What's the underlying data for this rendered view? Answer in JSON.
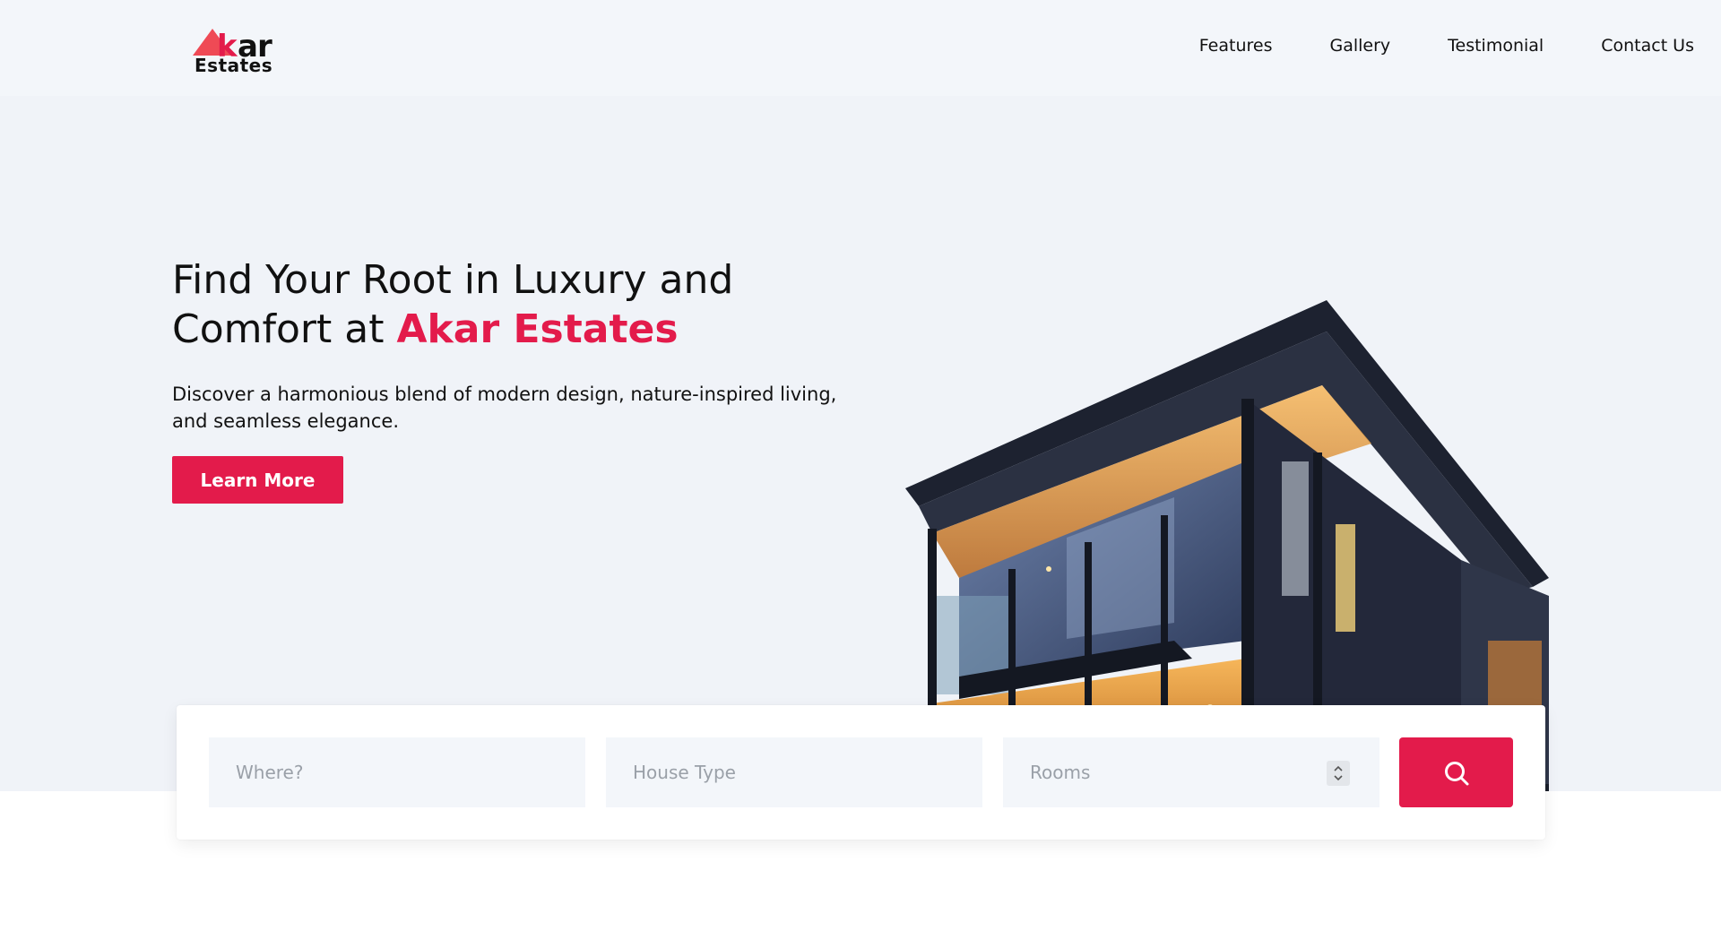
{
  "brand": {
    "logo_prefix_k": "k",
    "logo_suffix": "ar",
    "logo_sub": "Estates",
    "accent_color": "#e31b4b"
  },
  "nav": {
    "items": [
      {
        "label": "Features"
      },
      {
        "label": "Gallery"
      },
      {
        "label": "Testimonial"
      },
      {
        "label": "Contact Us"
      }
    ]
  },
  "hero": {
    "headline_line1": "Find Your Root in Luxury and",
    "headline_line2_prefix": "Comfort at ",
    "headline_brand": "Akar Estates",
    "subtext": "Discover a harmonious blend of modern design, nature-inspired living, and seamless elegance.",
    "cta_label": "Learn More",
    "image_alt": "modern-house-photo"
  },
  "search": {
    "where_placeholder": "Where?",
    "type_placeholder": "House Type",
    "rooms_placeholder": "Rooms",
    "button_icon": "search-icon"
  }
}
